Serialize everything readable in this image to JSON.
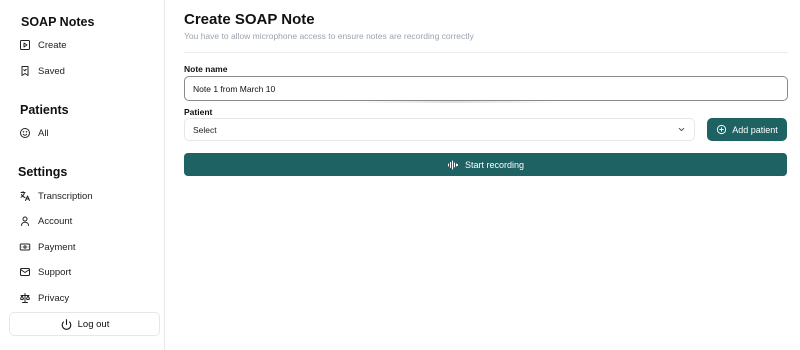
{
  "sidebar": {
    "soap_title": "SOAP Notes",
    "soap_items": [
      {
        "label": "Create",
        "icon": "play-square-icon"
      },
      {
        "label": "Saved",
        "icon": "bookmark-icon"
      }
    ],
    "patients_title": "Patients",
    "patients_items": [
      {
        "label": "All",
        "icon": "smile-icon"
      }
    ],
    "settings_title": "Settings",
    "settings_items": [
      {
        "label": "Transcription",
        "icon": "translate-icon"
      },
      {
        "label": "Account",
        "icon": "user-icon"
      },
      {
        "label": "Payment",
        "icon": "banknote-icon"
      },
      {
        "label": "Support",
        "icon": "mail-icon"
      },
      {
        "label": "Privacy",
        "icon": "scale-icon"
      }
    ],
    "logout_label": "Log out"
  },
  "main": {
    "title": "Create SOAP Note",
    "subtitle": "You have to allow microphone access to ensure notes are recording correctly",
    "note_name_label": "Note name",
    "note_name_value": "Note 1 from March 10",
    "patient_label": "Patient",
    "patient_select_value": "Select",
    "add_patient_label": "Add patient",
    "start_recording_label": "Start recording"
  },
  "colors": {
    "accent": "#1e6264"
  }
}
